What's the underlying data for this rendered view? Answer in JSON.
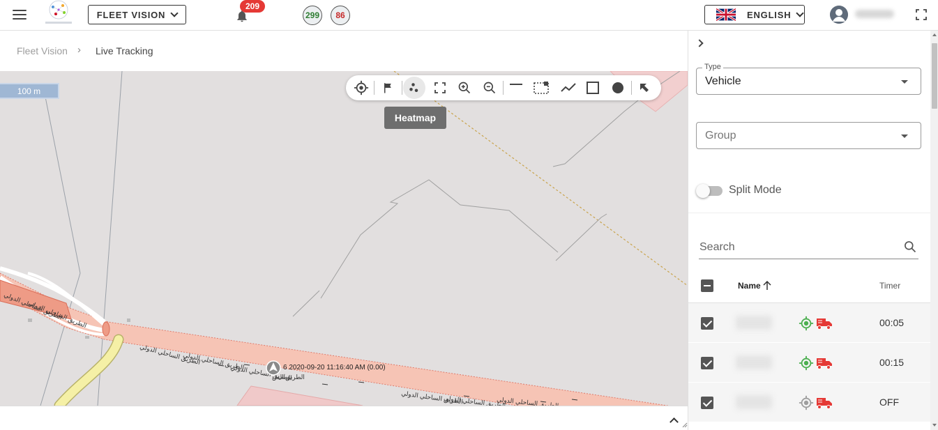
{
  "header": {
    "fleet_button_label": "FLEET VISION",
    "notification_count": "209",
    "count_green": "299",
    "count_red": "86",
    "language_label": "ENGLISH"
  },
  "breadcrumb": {
    "root": "Fleet Vision",
    "separator": "›",
    "current": "Live Tracking"
  },
  "map": {
    "scale_label": "100 m",
    "tooltip": "Heatmap",
    "vehicle_label": "6 2020-09-20 11:16:40 AM (0.00)",
    "road_label": "الطريق الساحلي الدولي",
    "road_label_short": "الطريق الس"
  },
  "toolbar_icons": [
    "locate-icon",
    "flag-icon",
    "heatmap-icon",
    "fit-bounds-icon",
    "zoom-in-icon",
    "zoom-out-icon",
    "measure-line-icon",
    "select-area-icon",
    "polyline-icon",
    "rectangle-icon",
    "circle-icon",
    "pointer-icon"
  ],
  "sidebar": {
    "type_legend": "Type",
    "type_value": "Vehicle",
    "group_placeholder": "Group",
    "split_mode_label": "Split Mode",
    "search_placeholder": "Search",
    "columns": {
      "name": "Name",
      "timer": "Timer"
    },
    "rows": [
      {
        "timer": "00:05",
        "location_status_color": "#4caf50"
      },
      {
        "timer": "00:15",
        "location_status_color": "#4caf50"
      },
      {
        "timer": "OFF",
        "location_status_color": "#9e9e9e"
      }
    ]
  },
  "colors": {
    "badge_red": "#e53935",
    "status_green": "#2e7d32",
    "status_red": "#c62828",
    "truck_red": "#e53935",
    "road_fill": "#f6c4b5",
    "map_bg": "#e2dfdf"
  }
}
